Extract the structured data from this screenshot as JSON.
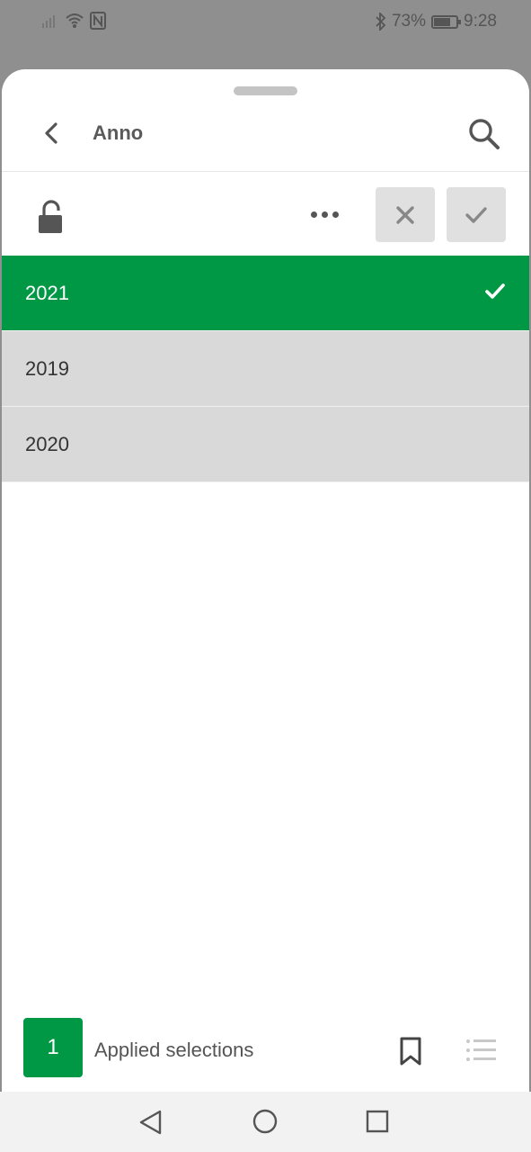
{
  "status_bar": {
    "battery": "73%",
    "time": "9:28"
  },
  "header": {
    "title": "Anno"
  },
  "list": {
    "items": [
      {
        "label": "2021",
        "state": "selected"
      },
      {
        "label": "2019",
        "state": "possible"
      },
      {
        "label": "2020",
        "state": "possible"
      }
    ]
  },
  "footer": {
    "count": "1",
    "applied_label": "Applied selections"
  },
  "colors": {
    "selected": "#009845",
    "possible": "#d9d9d9"
  }
}
